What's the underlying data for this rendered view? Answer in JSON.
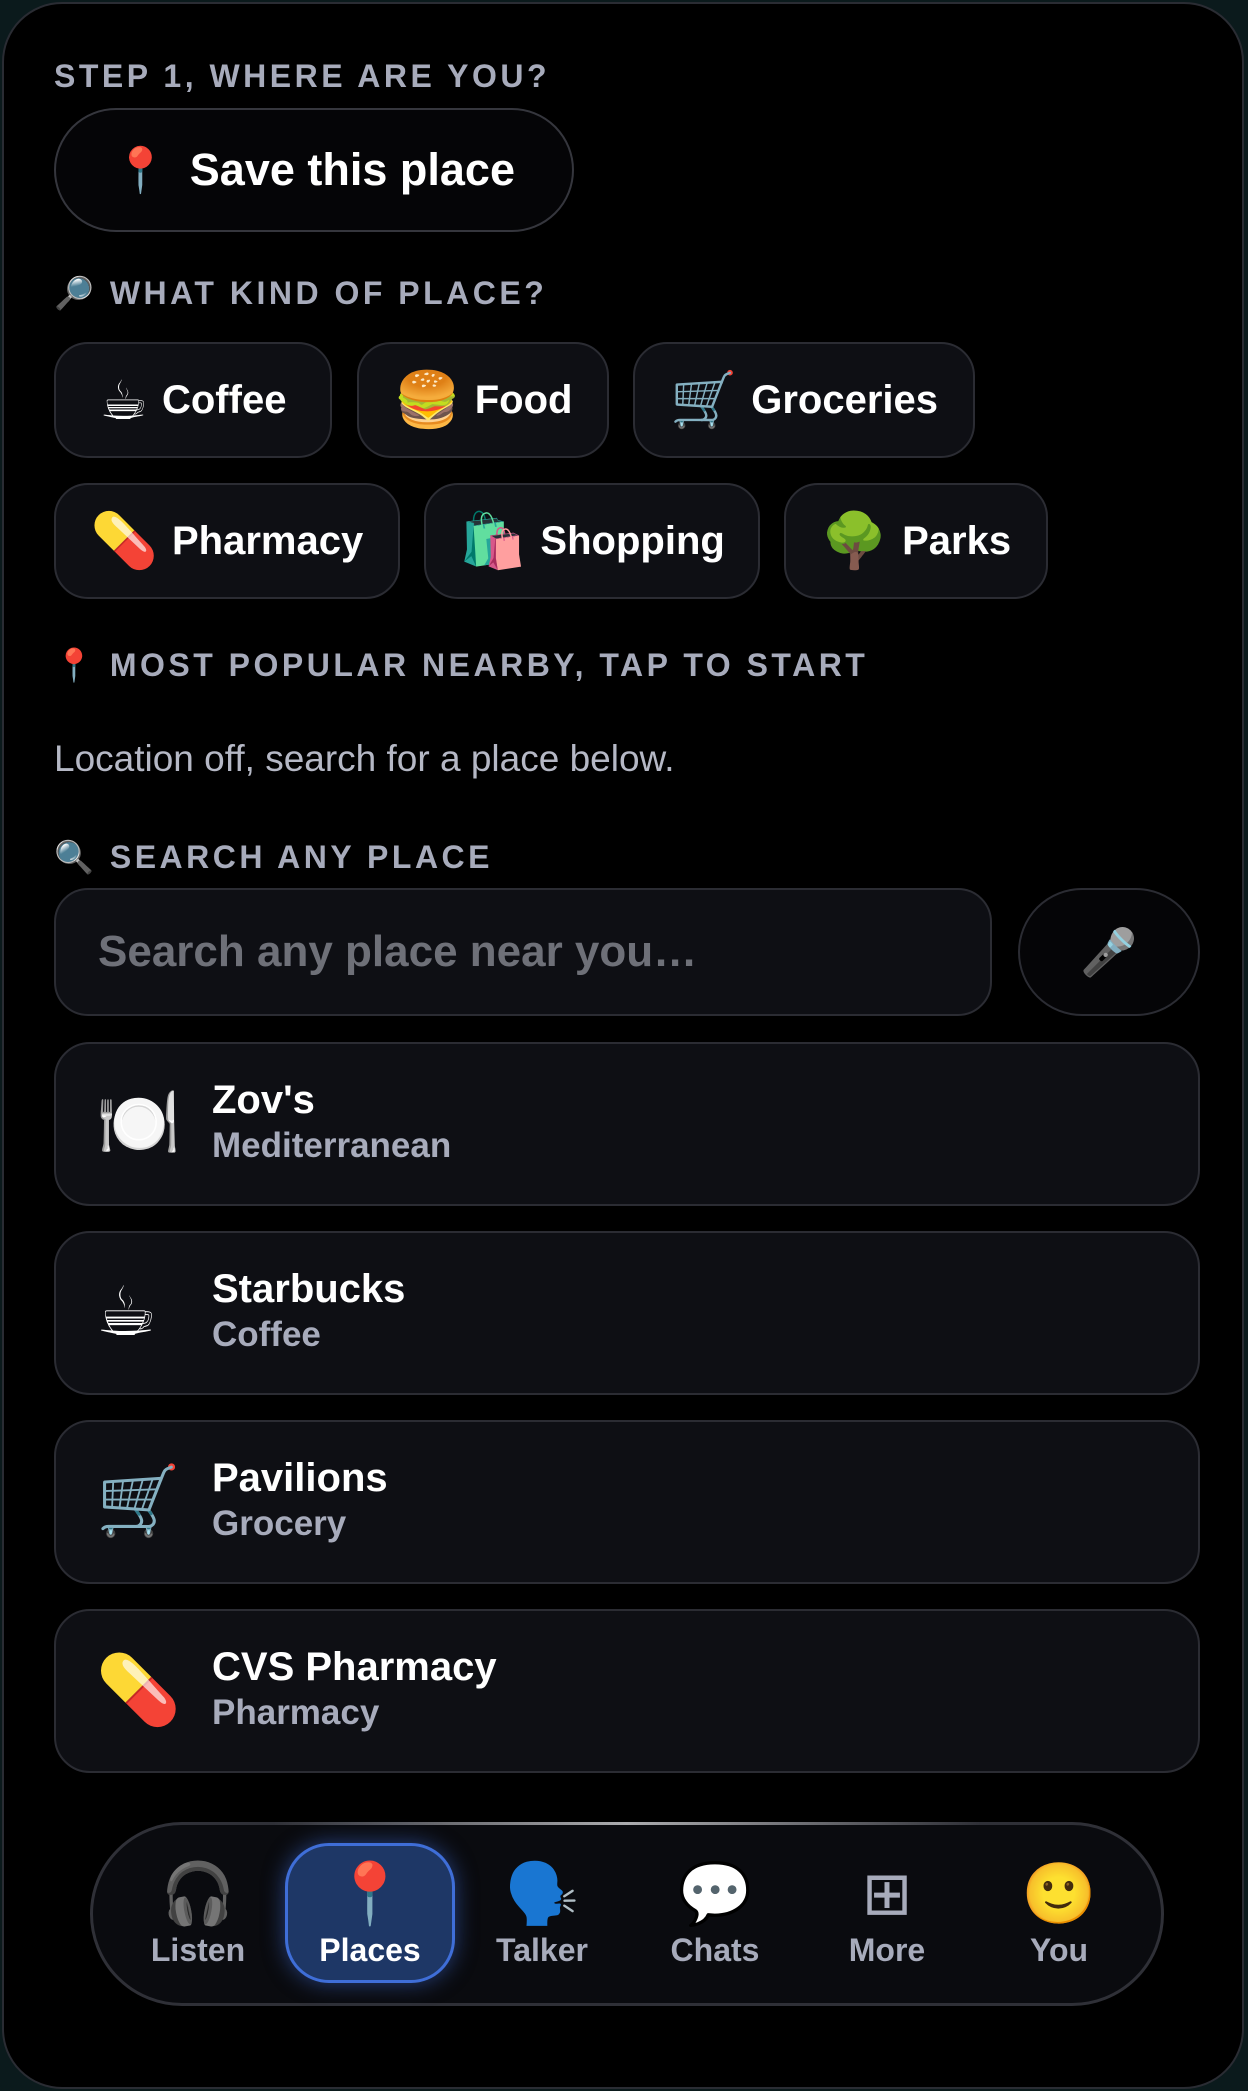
{
  "step_label": "STEP 1, WHERE ARE YOU?",
  "save_button": {
    "icon": "📍",
    "label": "Save this place"
  },
  "kind_section": {
    "icon": "🔎",
    "label": "WHAT KIND OF PLACE?",
    "chips": [
      {
        "icon": "☕",
        "label": "Coffee"
      },
      {
        "icon": "🍔",
        "label": "Food"
      },
      {
        "icon": "🛒",
        "label": "Groceries"
      },
      {
        "icon": "💊",
        "label": "Pharmacy"
      },
      {
        "icon": "🛍️",
        "label": "Shopping"
      },
      {
        "icon": "🌳",
        "label": "Parks"
      }
    ]
  },
  "popular_section": {
    "icon": "📍",
    "label": "MOST POPULAR NEARBY, TAP TO START",
    "status": "Location off, search for a place below."
  },
  "search_section": {
    "icon": "🔍",
    "label": "SEARCH ANY PLACE",
    "placeholder": "Search any place near you…",
    "value": "",
    "mic_icon": "🎤"
  },
  "places": [
    {
      "icon": "🍽️",
      "name": "Zov's",
      "category": "Mediterranean"
    },
    {
      "icon": "☕",
      "name": "Starbucks",
      "category": "Coffee"
    },
    {
      "icon": "🛒",
      "name": "Pavilions",
      "category": "Grocery"
    },
    {
      "icon": "💊",
      "name": "CVS Pharmacy",
      "category": "Pharmacy"
    }
  ],
  "nav": {
    "active": "Places",
    "items": [
      {
        "icon": "🎧",
        "label": "Listen"
      },
      {
        "icon": "📍",
        "label": "Places"
      },
      {
        "icon": "🗣️",
        "label": "Talker"
      },
      {
        "icon": "💬",
        "label": "Chats"
      },
      {
        "icon": "⊞",
        "label": "More"
      },
      {
        "icon": "🙂",
        "label": "You"
      }
    ]
  },
  "colors": {
    "background": "#000000",
    "card": "#0e0f14",
    "border": "#2b2c33",
    "label_gray": "#a7abbb",
    "accent_active": "#1e3766",
    "accent_border": "#3f6ed8"
  }
}
